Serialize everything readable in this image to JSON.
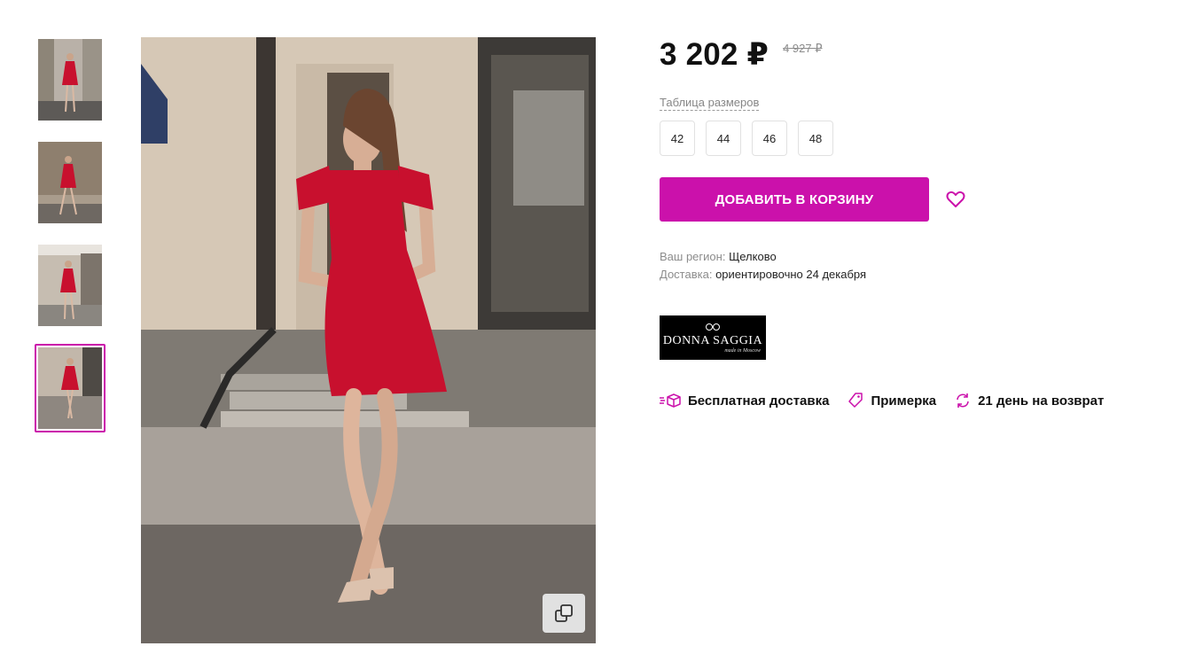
{
  "product": {
    "price": "3 202 ₽",
    "old_price": "4 927 ₽",
    "size_table_label": "Таблица размеров",
    "sizes": [
      "42",
      "44",
      "46",
      "48"
    ],
    "add_to_cart_label": "ДОБАВИТЬ В КОРЗИНУ"
  },
  "delivery": {
    "region_label": "Ваш регион:",
    "region_value": "Щелково",
    "date_label": "Доставка:",
    "date_value": "ориентировочно 24 декабря"
  },
  "brand": {
    "name": "DONNA SAGGIA",
    "subtitle": "made in Moscow"
  },
  "features": [
    {
      "icon": "delivery-box-icon",
      "label": "Бесплатная доставка"
    },
    {
      "icon": "tag-icon",
      "label": "Примерка"
    },
    {
      "icon": "return-arrows-icon",
      "label": "21 день на возврат"
    }
  ],
  "gallery": {
    "thumbnail_count": 4,
    "active_index": 3
  },
  "colors": {
    "accent": "#cb11ab",
    "dress": "#c8102e"
  }
}
